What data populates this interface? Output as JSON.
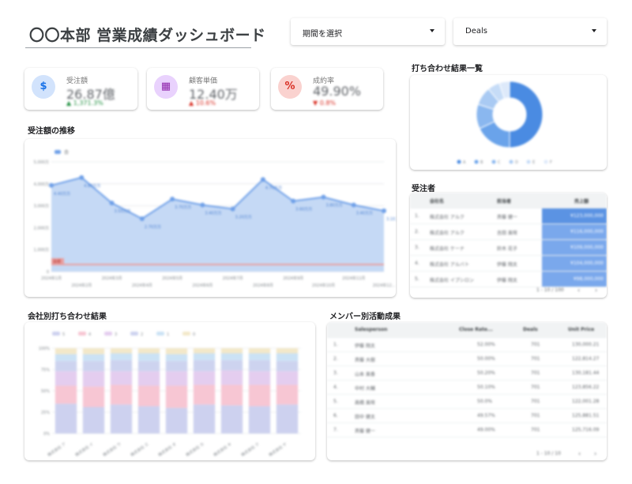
{
  "header": {
    "title": "〇〇本部 営業成績ダッシュボード",
    "period_dropdown": "期間を選択",
    "deals_dropdown": "Deals"
  },
  "kpis": [
    {
      "label": "受注額",
      "value": "26.87億",
      "change": "▲ 1,371.3%",
      "icon": "dollar-icon",
      "icon_bg": "#d2e3fc",
      "icon_fg": "#1a73e8",
      "change_color": "#1e8e3e"
    },
    {
      "label": "顧客単価",
      "value": "12.40万",
      "change": "▲ 10.6%",
      "icon": "building-icon",
      "icon_bg": "#e9d2fd",
      "icon_fg": "#8e24aa",
      "change_color": "#d93025"
    },
    {
      "label": "成約率",
      "value": "49.90%",
      "change": "▼ 0.8%",
      "icon": "percent-icon",
      "icon_bg": "#fad2cf",
      "icon_fg": "#d93025",
      "change_color": "#d93025"
    }
  ],
  "sections": {
    "line_title": "受注額の推移",
    "donut_title": "打ち合わせ結果一覧",
    "orders_title": "受注者",
    "stacked_title": "会社別打ち合わせ結果",
    "members_title": "メンバー別活動成果"
  },
  "line_legend": "合",
  "donut_legend": [
    "A",
    "B",
    "C",
    "D",
    "E",
    "F"
  ],
  "stacked_legend": [
    "5",
    "4",
    "3",
    "2",
    "1",
    "0"
  ],
  "orders_table": {
    "headers": [
      "会社名",
      "担当者",
      "売上額"
    ],
    "rows": [
      [
        "1.",
        "株式会社 アルク",
        "斉藤 健一",
        "¥123,000,000"
      ],
      [
        "2.",
        "株式会社 アルク",
        "吉田 美咲",
        "¥116,000,000"
      ],
      [
        "3.",
        "株式会社 ケーナ",
        "鈴木 花子",
        "¥109,000,000"
      ],
      [
        "4.",
        "株式会社 アルバト",
        "伊藤 翔太",
        "¥104,000,000"
      ],
      [
        "5.",
        "株式会社 イプシロン",
        "伊藤 翔太",
        "¥98,000,000"
      ]
    ],
    "pager": "1 - 10 / 100"
  },
  "members_table": {
    "headers": [
      "Salesperson",
      "Close Rate...",
      "Deals",
      "Unit Price"
    ],
    "rows": [
      [
        "1.",
        "伊藤 翔太",
        "52.00%",
        "701",
        "130,000.21"
      ],
      [
        "2.",
        "斉藤 大樹",
        "50.00%",
        "701",
        "122,814.27"
      ],
      [
        "3.",
        "山本 美香",
        "50.20%",
        "701",
        "130,181.44"
      ],
      [
        "4.",
        "中村 大輔",
        "50.10%",
        "701",
        "123,856.22"
      ],
      [
        "5.",
        "高橋 美咲",
        "50.0%",
        "701",
        "122,001.28"
      ],
      [
        "6.",
        "田中 健太",
        "49.57%",
        "701",
        "125,881.51"
      ],
      [
        "7.",
        "斉藤 健一",
        "49.00%",
        "701",
        "125,716.09"
      ]
    ],
    "pager": "1 - 10 / 10"
  },
  "chart_data": [
    {
      "type": "area",
      "title": "受注額の推移",
      "x": [
        "2024年1月",
        "2024年2月",
        "2024年3月",
        "2024年4月",
        "2024年5月",
        "2024年6月",
        "2024年7月",
        "2024年8月",
        "2024年9月",
        "2024年10月",
        "2024年11月",
        "2024年12月"
      ],
      "x_tick_labels": [
        "2024年1月",
        "2024年3月",
        "2024年5月",
        "2024年7月",
        "2024年9月",
        "2024年11月"
      ],
      "x_tick_labels_lower": [
        "2024年2月",
        "2024年4月",
        "2024年6月",
        "2024年8月",
        "2024年10月",
        "2024年12..."
      ],
      "series": [
        {
          "name": "合",
          "values": [
            4.4,
            4.8,
            3.5,
            2.7,
            3.7,
            3.4,
            3.2,
            4.7,
            3.6,
            3.8,
            3.4,
            3.1
          ],
          "labels": [
            "4.40万万",
            "4.80万万",
            "3.50万万",
            "2.70万万",
            "3.70万万",
            "3.40万万",
            "3.20万万",
            "4.70万万",
            "3.60万万",
            "3.80万万",
            "3.40万万",
            "3.10万万"
          ]
        }
      ],
      "y_ticks": [
        "0",
        "1,000万",
        "2,000万",
        "3,000万",
        "4,000万",
        "5,000万"
      ],
      "ylim": [
        0,
        5.6
      ],
      "reference_label": "目標",
      "color": "#6fa0e8"
    },
    {
      "type": "pie",
      "title": "打ち合わせ結果一覧",
      "categories": [
        "A",
        "B",
        "C",
        "D",
        "E",
        "F"
      ],
      "values": [
        50,
        18,
        12,
        9,
        6,
        5
      ],
      "colors": [
        "#4a8be2",
        "#6aa3ea",
        "#8ab7ef",
        "#a9caf3",
        "#c6dcf7",
        "#dde9fa"
      ]
    },
    {
      "type": "bar",
      "title": "会社別打ち合わせ結果",
      "categories": [
        "株式会社 ア",
        "株式会社 イ",
        "株式会社 ウ",
        "株式会社 エ",
        "株式会社 オ",
        "株式会社 カ",
        "株式会社 キ",
        "株式会社 ク",
        "株式会社 ケ"
      ],
      "y_ticks": [
        "0%",
        "25%",
        "50%",
        "75%",
        "100%"
      ],
      "series": [
        {
          "name": "5",
          "values": [
            35,
            31,
            34,
            32,
            30,
            34,
            33,
            32,
            34
          ],
          "color": "#cdd1ef"
        },
        {
          "name": "4",
          "values": [
            21,
            24,
            23,
            24,
            26,
            23,
            24,
            25,
            23
          ],
          "color": "#f7c6d3"
        },
        {
          "name": "3",
          "values": [
            17,
            18,
            16,
            17,
            17,
            16,
            17,
            16,
            16
          ],
          "color": "#e4cdef"
        },
        {
          "name": "2",
          "values": [
            12,
            12,
            13,
            12,
            12,
            13,
            12,
            13,
            12
          ],
          "color": "#cdd3ef"
        },
        {
          "name": "1",
          "values": [
            8,
            8,
            8,
            9,
            8,
            8,
            8,
            8,
            9
          ],
          "color": "#cbe2f5"
        },
        {
          "name": "0",
          "values": [
            7,
            7,
            6,
            6,
            7,
            6,
            6,
            6,
            6
          ],
          "color": "#f3e8c9"
        }
      ]
    }
  ]
}
